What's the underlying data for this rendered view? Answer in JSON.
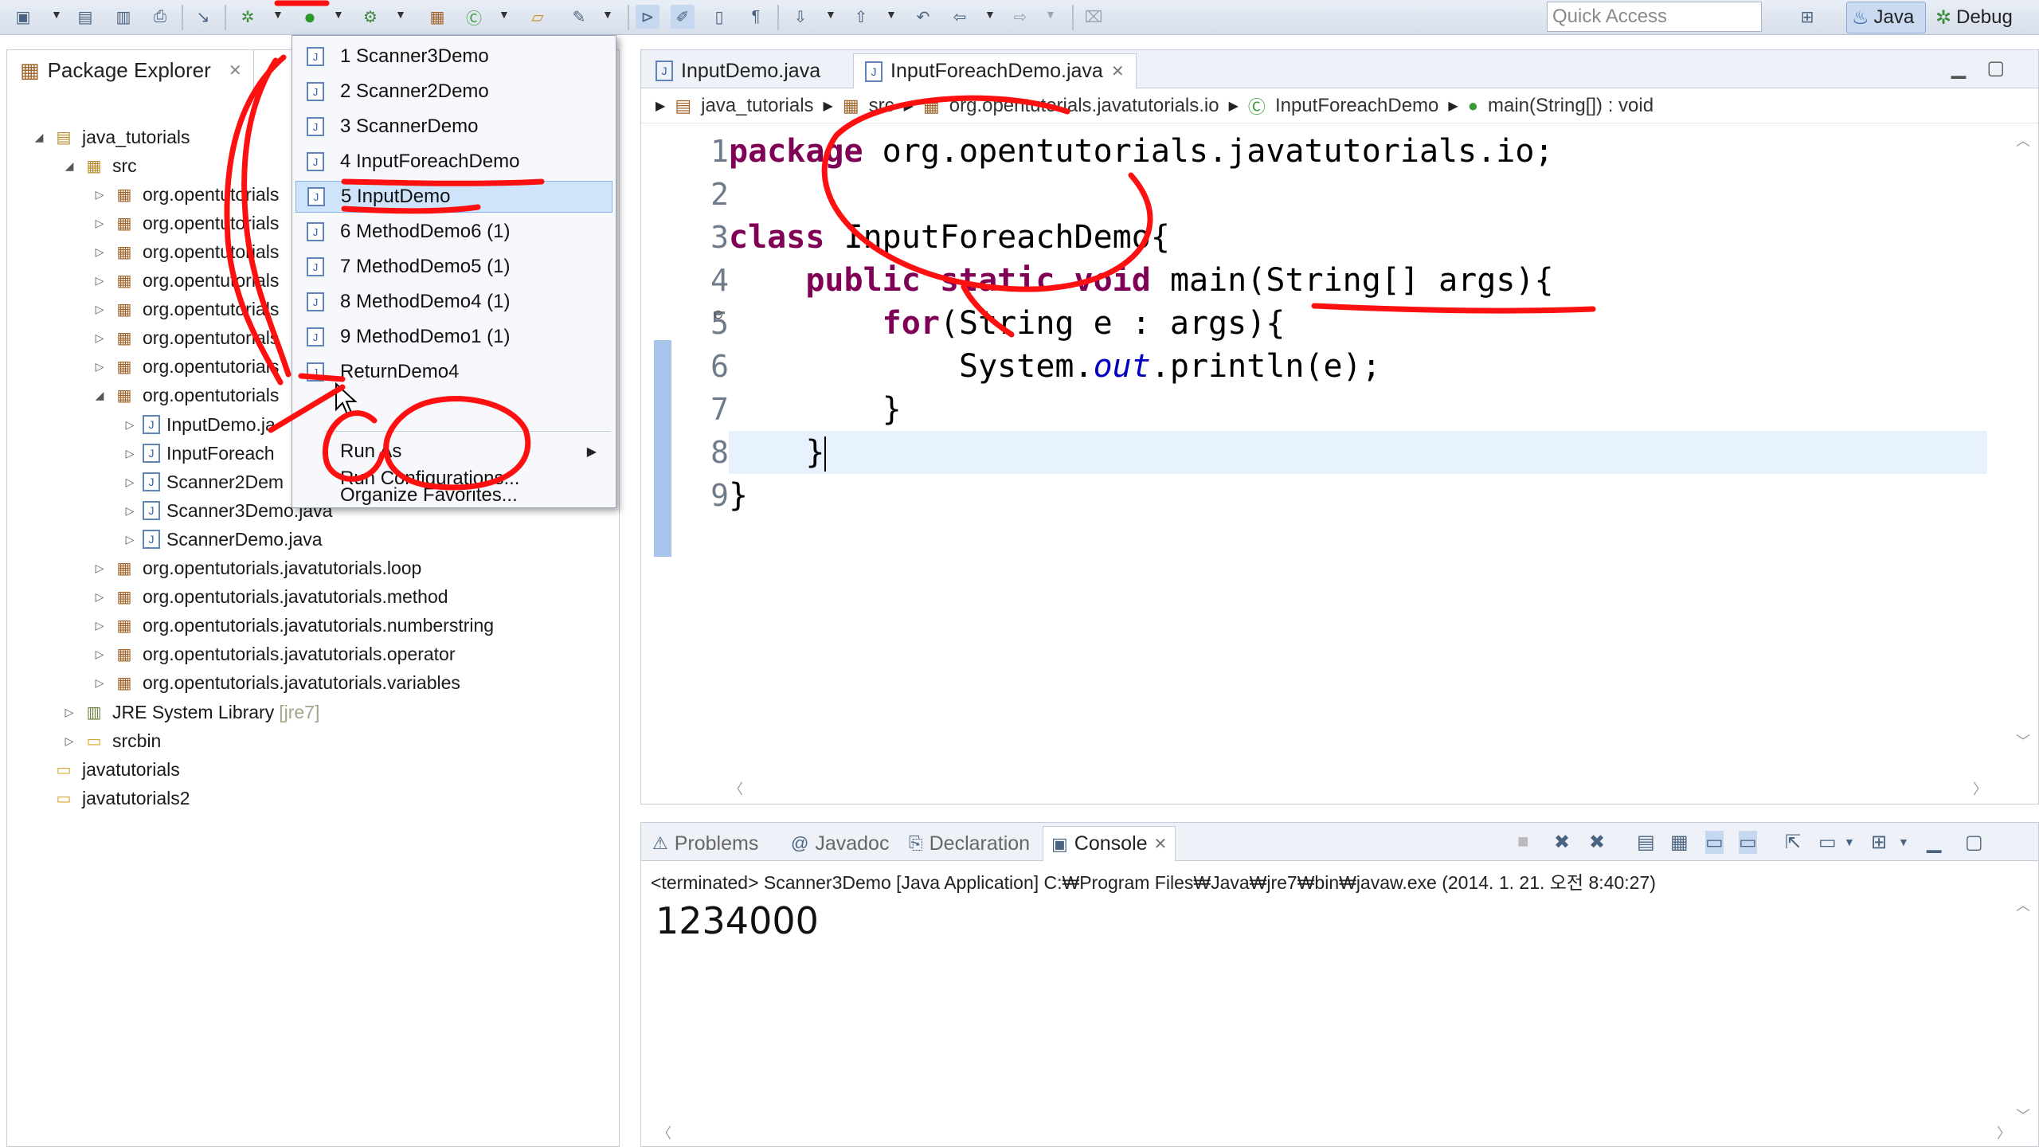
{
  "toolbar": {
    "quick_access_placeholder": "Quick Access",
    "perspective_java": "Java",
    "perspective_debug": "Debug"
  },
  "package_explorer": {
    "title": "Package Explorer",
    "tree": [
      {
        "label": "java_tutorials",
        "icon": "project-icon",
        "depth": 0,
        "expanded": true
      },
      {
        "label": "src",
        "icon": "source-folder-icon",
        "depth": 1,
        "expanded": true
      },
      {
        "label": "org.opentutorials",
        "icon": "package-icon",
        "depth": 2
      },
      {
        "label": "org.opentutorials",
        "icon": "package-icon",
        "depth": 2
      },
      {
        "label": "org.opentutorials",
        "icon": "package-icon",
        "depth": 2
      },
      {
        "label": "org.opentutorials",
        "icon": "package-icon",
        "depth": 2
      },
      {
        "label": "org.opentutorials",
        "icon": "package-icon",
        "depth": 2
      },
      {
        "label": "org.opentutorials",
        "icon": "package-icon",
        "depth": 2
      },
      {
        "label": "org.opentutorials",
        "icon": "package-icon",
        "depth": 2
      },
      {
        "label": "org.opentutorials",
        "icon": "package-icon",
        "depth": 2,
        "expanded": true
      },
      {
        "label": "InputDemo.ja",
        "icon": "java-file-icon",
        "depth": 3
      },
      {
        "label": "InputForeach",
        "icon": "java-file-icon",
        "depth": 3
      },
      {
        "label": "Scanner2Dem",
        "icon": "java-file-icon",
        "depth": 3
      },
      {
        "label": "Scanner3Demo.java",
        "icon": "java-file-icon",
        "depth": 3
      },
      {
        "label": "ScannerDemo.java",
        "icon": "java-file-icon",
        "depth": 3
      },
      {
        "label": "org.opentutorials.javatutorials.loop",
        "icon": "package-icon",
        "depth": 2
      },
      {
        "label": "org.opentutorials.javatutorials.method",
        "icon": "package-icon",
        "depth": 2
      },
      {
        "label": "org.opentutorials.javatutorials.numberstring",
        "icon": "package-icon",
        "depth": 2
      },
      {
        "label": "org.opentutorials.javatutorials.operator",
        "icon": "package-icon",
        "depth": 2
      },
      {
        "label": "org.opentutorials.javatutorials.variables",
        "icon": "package-icon",
        "depth": 2
      },
      {
        "label": "JRE System Library",
        "suffix": "[jre7]",
        "icon": "library-icon",
        "depth": 1
      },
      {
        "label": "srcbin",
        "icon": "folder-icon",
        "depth": 1
      },
      {
        "label": "javatutorials",
        "icon": "project-folder-icon",
        "depth": 0
      },
      {
        "label": "javatutorials2",
        "icon": "project-folder-icon",
        "depth": 0
      }
    ]
  },
  "run_menu": {
    "items": [
      {
        "label": "1 Scanner3Demo"
      },
      {
        "label": "2 Scanner2Demo"
      },
      {
        "label": "3 ScannerDemo"
      },
      {
        "label": "4 InputForeachDemo"
      },
      {
        "label": "5 InputDemo",
        "selected": true
      },
      {
        "label": "6 MethodDemo6 (1)"
      },
      {
        "label": "7 MethodDemo5 (1)"
      },
      {
        "label": "8 MethodDemo4 (1)"
      },
      {
        "label": "9 MethodDemo1 (1)"
      },
      {
        "label": "ReturnDemo4"
      }
    ],
    "run_as": "Run As",
    "run_configurations": "Run Configurations...",
    "organize_favorites": "Organize Favorites..."
  },
  "editor": {
    "tabs": [
      {
        "label": "InputDemo.java",
        "active": false
      },
      {
        "label": "InputForeachDemo.java",
        "active": true
      }
    ],
    "breadcrumb": [
      "java_tutorials",
      "src",
      "org.opentutorials.javatutorials.io",
      "InputForeachDemo",
      "main(String[]) : void"
    ],
    "line_numbers": [
      "1",
      "2",
      "3",
      "4",
      "5",
      "6",
      "7",
      "8",
      "9"
    ]
  },
  "console": {
    "tabs": [
      {
        "label": "Problems",
        "icon": "problems-icon"
      },
      {
        "label": "Javadoc",
        "icon": "javadoc-icon"
      },
      {
        "label": "Declaration",
        "icon": "declaration-icon"
      },
      {
        "label": "Console",
        "icon": "console-icon",
        "active": true
      }
    ],
    "status": "<terminated> Scanner3Demo [Java Application] C:₩Program Files₩Java₩jre7₩bin₩javaw.exe (2014. 1. 21. 오전 8:40:27)",
    "output": "1234000"
  },
  "colors": {
    "keyword": "#7f0055",
    "field": "#0000c0",
    "annotation_red": "#ff0000",
    "menu_selected": "#cfe3fb"
  }
}
